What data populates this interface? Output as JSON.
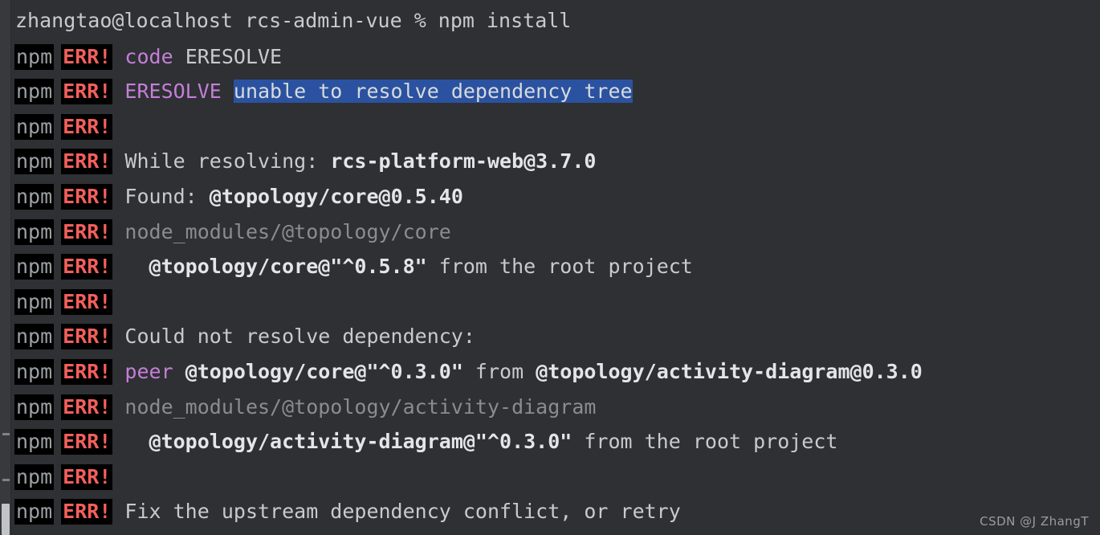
{
  "terminal": {
    "background_color": "#2e3033",
    "foreground_color": "#c8cacc",
    "badge_background": "#000000",
    "npm_color": "#9ba0a4",
    "err_color": "#f25f5c",
    "magenta_color": "#c57fd8",
    "dim_color": "#8a8d90",
    "selection_color": "#2a52a0",
    "prompt_line": "zhangtao@localhost rcs-admin-vue % npm install",
    "badge_npm": "npm",
    "badge_err": "ERR!",
    "lines": [
      {
        "id": "line-code-eresolve",
        "segments": [
          {
            "text": " code ",
            "style": "magenta-lead"
          },
          {
            "text": "ERESOLVE",
            "style": "normal"
          }
        ]
      },
      {
        "id": "line-eresolve-unable",
        "segments": [
          {
            "text": " ERESOLVE ",
            "style": "magenta"
          },
          {
            "text": "unable to resolve dependency tree",
            "style": "selected"
          }
        ]
      },
      {
        "id": "line-blank-1",
        "segments": []
      },
      {
        "id": "line-while-resolving",
        "segments": [
          {
            "text": " While resolving: ",
            "style": "normal"
          },
          {
            "text": "rcs-platform-web@3.7.0",
            "style": "bold"
          }
        ]
      },
      {
        "id": "line-found",
        "segments": [
          {
            "text": " Found: ",
            "style": "normal"
          },
          {
            "text": "@topology/core@0.5.40",
            "style": "bold"
          }
        ]
      },
      {
        "id": "line-node-modules-core",
        "segments": [
          {
            "text": " node_modules/@topology/core",
            "style": "dim"
          }
        ]
      },
      {
        "id": "line-core-root-project",
        "segments": [
          {
            "text": "   ",
            "style": "normal"
          },
          {
            "text": "@topology/core@\"^0.5.8\"",
            "style": "bold"
          },
          {
            "text": " from the root project",
            "style": "normal"
          }
        ]
      },
      {
        "id": "line-blank-2",
        "segments": []
      },
      {
        "id": "line-could-not-resolve",
        "segments": [
          {
            "text": " Could not resolve dependency:",
            "style": "normal"
          }
        ]
      },
      {
        "id": "line-peer",
        "segments": [
          {
            "text": " peer ",
            "style": "magenta"
          },
          {
            "text": "@topology/core@\"^0.3.0\"",
            "style": "bold"
          },
          {
            "text": " from ",
            "style": "normal"
          },
          {
            "text": "@topology/activity-diagram@0.3.0",
            "style": "bold"
          }
        ]
      },
      {
        "id": "line-node-modules-activity",
        "segments": [
          {
            "text": " node_modules/@topology/activity-diagram",
            "style": "dim"
          }
        ]
      },
      {
        "id": "line-activity-root-project",
        "segments": [
          {
            "text": "   ",
            "style": "normal"
          },
          {
            "text": "@topology/activity-diagram@\"^0.3.0\"",
            "style": "bold"
          },
          {
            "text": " from the root project",
            "style": "normal"
          }
        ]
      },
      {
        "id": "line-blank-3",
        "segments": []
      },
      {
        "id": "line-fix-upstream",
        "segments": [
          {
            "text": " Fix the upstream dependency conflict, or retry",
            "style": "normal"
          }
        ]
      }
    ]
  },
  "watermark": {
    "text": "CSDN @J ZhangT"
  },
  "scrollbar": {
    "thumb_color": "#c2c4c6",
    "track_color": "#37393c"
  }
}
